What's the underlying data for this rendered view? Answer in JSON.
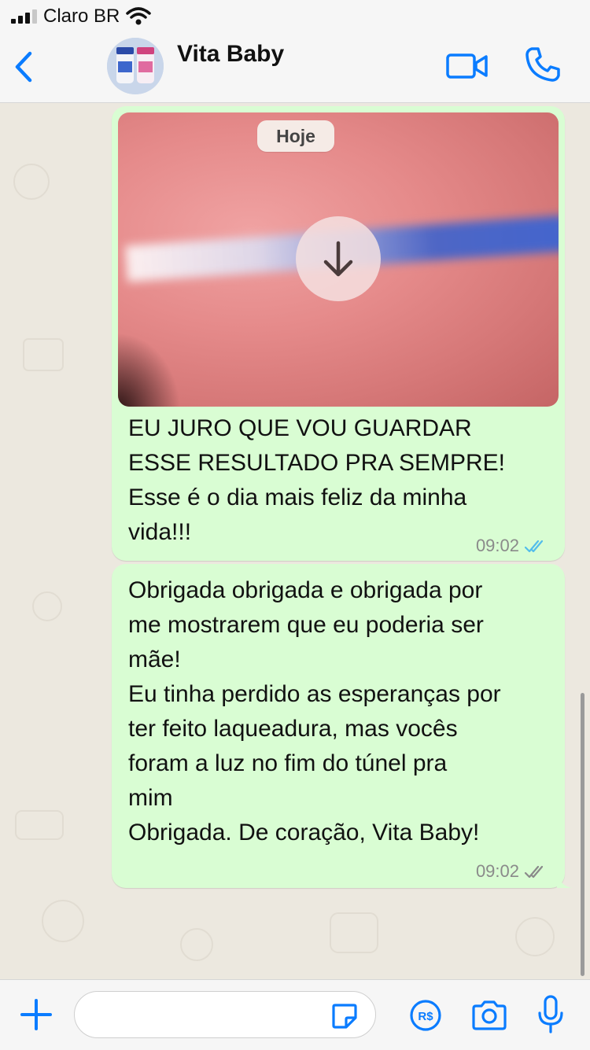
{
  "status_bar": {
    "carrier": "Claro BR"
  },
  "header": {
    "contact_name": "Vita Baby",
    "icons": {
      "back": "chevron-left-icon",
      "video": "video-call-icon",
      "call": "phone-icon"
    }
  },
  "messages": [
    {
      "type": "image-with-caption",
      "date_chip": "Hoje",
      "text": "EU JURO QUE VOU GUARDAR\nESSE RESULTADO PRA SEMPRE!\nEsse é o dia mais feliz da minha\nvida!!!",
      "time": "09:02",
      "status": "read"
    },
    {
      "type": "text",
      "text": "Obrigada obrigada e obrigada por\nme mostrarem que eu poderia ser\nmãe!\nEu tinha perdido as esperanças por\nter feito laqueadura, mas vocês\nforam a luz no fim do túnel pra\nmim\nObrigada. De coração, Vita Baby!",
      "time": "09:02",
      "status": "delivered"
    }
  ],
  "input_bar": {
    "placeholder": "",
    "icons": {
      "plus": "plus-icon",
      "sticker": "sticker-icon",
      "pay": "payment-icon",
      "camera": "camera-icon",
      "mic": "microphone-icon"
    }
  },
  "colors": {
    "accent": "#0a7cff",
    "bubble_outgoing": "#d9fdd3",
    "read_tick": "#53bdeb",
    "chat_background": "#ece8df"
  }
}
